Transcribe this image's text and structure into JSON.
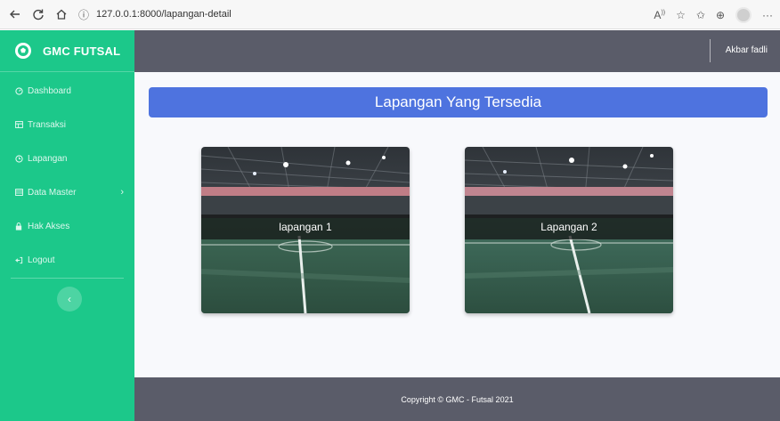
{
  "browser": {
    "url": "127.0.0.1:8000/lapangan-detail"
  },
  "sidebar": {
    "brand": "GMC FUTSAL",
    "items": [
      {
        "label": "Dashboard",
        "icon": "dashboard-icon"
      },
      {
        "label": "Transaksi",
        "icon": "table-icon"
      },
      {
        "label": "Lapangan",
        "icon": "clock-icon"
      },
      {
        "label": "Data Master",
        "icon": "folder-icon"
      },
      {
        "label": "Hak Akses",
        "icon": "lock-icon"
      },
      {
        "label": "Logout",
        "icon": "logout-icon"
      }
    ]
  },
  "topbar": {
    "user": "Akbar fadli"
  },
  "main": {
    "title": "Lapangan Yang Tersedia",
    "courts": [
      {
        "label": "lapangan 1"
      },
      {
        "label": "Lapangan 2"
      }
    ]
  },
  "footer": {
    "text": "Copyright © GMC - Futsal 2021"
  },
  "colors": {
    "sidebar": "#1cc88a",
    "topbar": "#5a5c69",
    "banner": "#4e73df",
    "content_bg": "#f8f9fc"
  }
}
